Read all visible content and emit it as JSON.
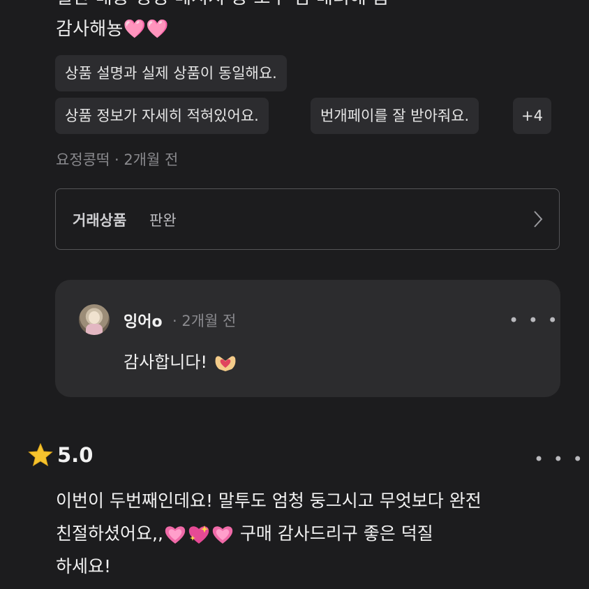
{
  "review_top": {
    "partial_line": "일단 배송 정성 메시지 등 모두 넘 배려해 줌",
    "line2_text": "감사해뇽",
    "line2_emoji": "🩷🩷",
    "chips": [
      "상품 설명과 실제 상품이 동일해요.",
      "상품 정보가 자세히 적혀있어요.",
      "번개페이를 잘 받아줘요.",
      "+4"
    ],
    "author": "요정콩떡",
    "separator": " · ",
    "date": "2개월 전",
    "product_key": "거래상품",
    "product_value": "판완"
  },
  "reply": {
    "name": "잉어o",
    "date": "· 2개월 전",
    "text": "감사합니다!",
    "more": "• • •"
  },
  "review_next": {
    "rating": "5.0",
    "more": "• • •",
    "line1": "이번이 두번째인데요! 말투도 엄청 둥그시고 무엇보다 완전",
    "line2_a": "친절하셨어요,,",
    "line2_b": "구매 감사드리구 좋은 덕질",
    "line3": "하세요!"
  },
  "colors": {
    "background": "#1c1c1e",
    "chip": "#2c2c2f",
    "reply_card": "#2c2c2e",
    "star": "#f6c32e",
    "heart": "#f5a3c7"
  }
}
